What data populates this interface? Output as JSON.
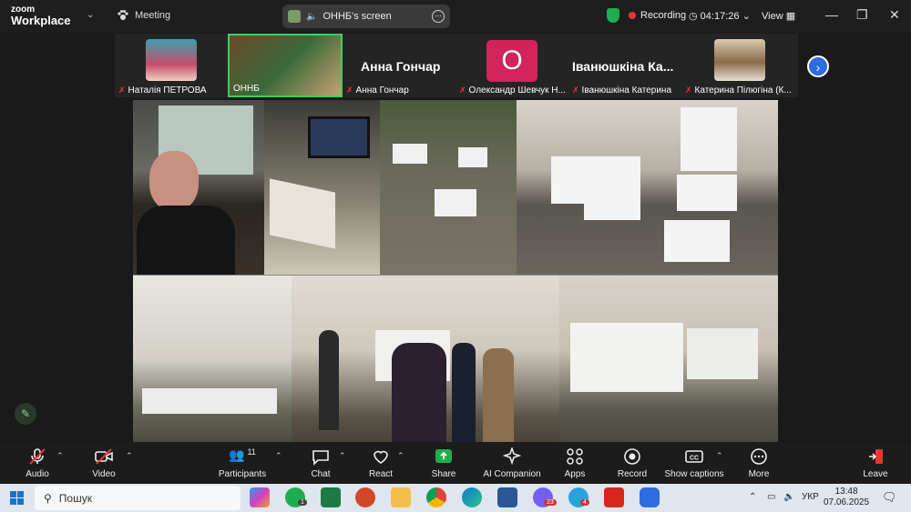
{
  "app": {
    "brand_top": "zoom",
    "brand_bottom": "Workplace"
  },
  "topbar": {
    "meeting_label": "Meeting",
    "screen_label": "ОННБ's screen",
    "recording_label": "Recording",
    "timer": "04:17:26",
    "view_label": "View"
  },
  "participants": [
    {
      "name": "Наталія ПЕТРОВА",
      "muted": true
    },
    {
      "name": "ОННБ",
      "muted": false,
      "active": true
    },
    {
      "name": "Анна Гончар",
      "display_name": "Анна Гончар",
      "muted": true
    },
    {
      "name": "Олександр Шевчук Н...",
      "avatar_letter": "О",
      "muted": true
    },
    {
      "name": "Іванюшкіна Катерина",
      "display_name": "Іванюшкіна Ка...",
      "muted": true
    },
    {
      "name": "Катерина Пілюгіна (К...",
      "muted": true
    }
  ],
  "toolbar": {
    "audio": "Audio",
    "video": "Video",
    "participants": "Participants",
    "participants_count": "11",
    "chat": "Chat",
    "react": "React",
    "share": "Share",
    "ai_companion": "AI Companion",
    "apps": "Apps",
    "record": "Record",
    "show_captions": "Show captions",
    "more": "More",
    "leave": "Leave"
  },
  "taskbar": {
    "search_placeholder": "Пошук",
    "whatsapp_badge": "1",
    "viber_badge": "23",
    "telegram_badge": "4",
    "language": "УКР",
    "time": "13:48",
    "date": "07.06.2025"
  },
  "colors": {
    "accent_blue": "#2d6de0",
    "share_green": "#1fae4f",
    "recording_red": "#e33333",
    "active_border": "#3ad15a"
  }
}
